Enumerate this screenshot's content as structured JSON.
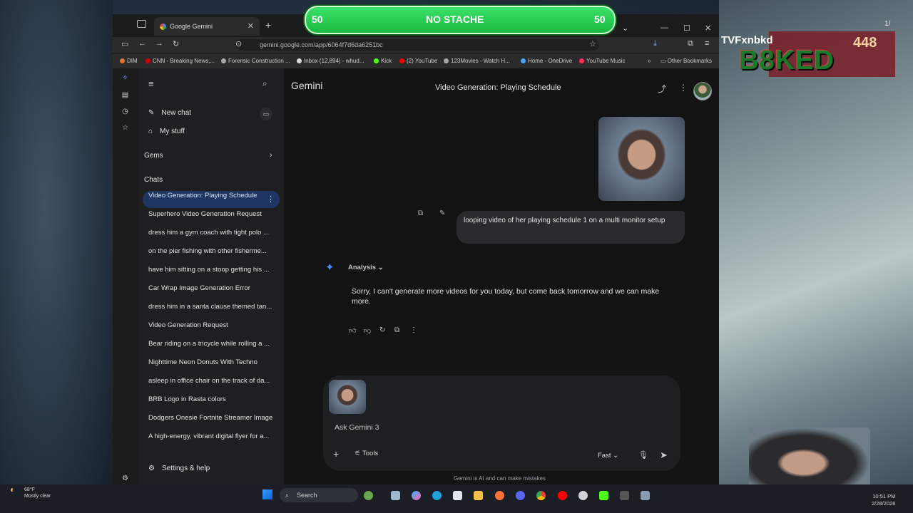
{
  "overlay": {
    "vote_left": "50",
    "vote_label": "NO STACHE",
    "vote_right": "50"
  },
  "team": {
    "name": "TVFxnbkd",
    "score": "448",
    "logo_text": "B8KED",
    "page_counter": "1/"
  },
  "browser": {
    "tab_title": "Google Gemini",
    "url": "gemini.google.com/app/6064f7d6da6251bc",
    "bookmarks": [
      "DIM",
      "CNN - Breaking News,...",
      "Forensic Construction ...",
      "Inbox (12,894) - whud...",
      "Kick",
      "(2) YouTube",
      "123Movies - Watch H...",
      "Home - OneDrive",
      "YouTube Music"
    ],
    "other_bookmarks": "Other Bookmarks"
  },
  "sidebar": {
    "new_chat": "New chat",
    "my_stuff": "My stuff",
    "gems": "Gems",
    "chats_heading": "Chats",
    "chats": [
      "Video Generation: Playing Schedule",
      "Superhero Video Generation Request",
      "dress him a gym coach with tight polo ...",
      "on the pier fishing with other fisherme...",
      "have him sitting on a stoop getting his ...",
      "Car Wrap Image Generation Error",
      "dress him in a santa clause themed tan...",
      "Video Generation Request",
      "Bear riding on a tricycle while rolling a ...",
      "Nighttime Neon Donuts With Techno",
      "asleep in office chair on the track of da...",
      "BRB Logo in Rasta colors",
      "Dodgers Onesie Fortnite Streamer Image",
      "A high-energy, vibrant digital flyer for a..."
    ],
    "settings": "Settings & help"
  },
  "main": {
    "app_title": "Gemini",
    "conversation_title": "Video Generation: Playing Schedule",
    "user_message": "looping video of her playing schedule 1 on a multi monitor setup",
    "analysis_label": "Analysis",
    "reply": "Sorry, I can't generate more videos for you today, but come back tomorrow and we can make more.",
    "composer_placeholder": "Ask Gemini 3",
    "tools_label": "Tools",
    "mode_label": "Fast",
    "footer": "Gemini is AI and can make mistakes"
  },
  "taskbar": {
    "weather_temp": "68°F",
    "weather_desc": "Mostly clear",
    "search_label": "Search",
    "time": "10:51 PM",
    "date": "2/28/2026"
  },
  "colors": {
    "accent": "#8ab4f8",
    "active_chat": "#1f3760",
    "vote_green": "#2fd05a"
  }
}
